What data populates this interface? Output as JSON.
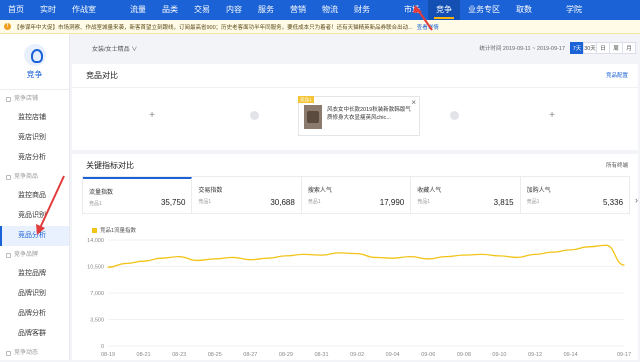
{
  "nav": {
    "items": [
      "首页",
      "实时",
      "作战室",
      "流量",
      "品类",
      "交易",
      "内容",
      "服务",
      "营销",
      "物流",
      "财务",
      "市场",
      "竞争",
      "业务专区",
      "取数",
      "学院"
    ],
    "active_index": 12,
    "dot_indexes": [
      4,
      6
    ]
  },
  "notice": {
    "text": "【参谋年中大促】市场洞察、作战室城量来袭，新客首望立刻跟线，订阅最高省900；历史老客面功半年同服务，要低成本只为着者！还有天猫精英新品券联合出动...",
    "link": "查看详情"
  },
  "sidebar": {
    "title": "竞争",
    "sections": [
      {
        "label": "竞争店铺",
        "items": [
          "监控店铺",
          "竞店识别",
          "竞店分析"
        ]
      },
      {
        "label": "竞争商品",
        "items": [
          "监控商品",
          "竞品识别",
          "竞品分析"
        ]
      },
      {
        "label": "竞争品牌",
        "items": [
          "监控品牌",
          "品牌识别",
          "品牌分析",
          "品牌客群"
        ]
      },
      {
        "label": "竞争动态",
        "items": []
      }
    ],
    "active_item": "竞品分析"
  },
  "toolbar": {
    "category": "女装/女士精品 ∨",
    "period": "统计时间 2019-09-11 ~ 2019-09-17",
    "buttons": [
      "7天",
      "30天",
      "日",
      "周",
      "月"
    ],
    "active_button": 0
  },
  "compare": {
    "title": "竞品对比",
    "config": "竞品配置",
    "slot_plus": "+",
    "badge": "竞品1",
    "product_name": "风衣女中长款2019秋装新款韩版气质修身大衣显瘦英风chic...",
    "close": "×"
  },
  "indicators": {
    "title": "关键指标对比",
    "terminal": "所有终端",
    "metrics": [
      {
        "name": "流量指数",
        "label": "竞品1",
        "value": "35,750"
      },
      {
        "name": "交易指数",
        "label": "竞品1",
        "value": "30,688"
      },
      {
        "name": "搜索人气",
        "label": "竞品1",
        "value": "17,990"
      },
      {
        "name": "收藏人气",
        "label": "竞品1",
        "value": "3,815"
      },
      {
        "name": "加购人气",
        "label": "竞品1",
        "value": "5,336"
      }
    ],
    "selected_metric": 0
  },
  "chart_data": {
    "type": "line",
    "legend": "竞品1流量指数",
    "x": [
      "08-19",
      "08-20",
      "08-21",
      "08-22",
      "08-23",
      "08-24",
      "08-25",
      "08-26",
      "08-27",
      "08-28",
      "08-29",
      "08-30",
      "08-31",
      "09-01",
      "09-02",
      "09-03",
      "09-04",
      "09-05",
      "09-06",
      "09-07",
      "09-08",
      "09-09",
      "09-10",
      "09-11",
      "09-12",
      "09-13",
      "09-14",
      "09-15",
      "09-16",
      "09-17"
    ],
    "x_tick_labels": [
      "08-19",
      "08-21",
      "08-23",
      "08-25",
      "08-27",
      "08-29",
      "08-31",
      "09-02",
      "09-04",
      "09-06",
      "09-08",
      "09-10",
      "09-12",
      "09-14",
      "09-17"
    ],
    "series": [
      {
        "name": "竞品1流量指数",
        "color": "#f2c418",
        "values": [
          10400,
          10900,
          11200,
          11600,
          11800,
          11300,
          11500,
          11700,
          11400,
          11600,
          11900,
          12100,
          12000,
          12300,
          12200,
          11700,
          11600,
          11800,
          11500,
          11800,
          12000,
          12100,
          11900,
          11700,
          12100,
          12400,
          12700,
          13100,
          13300,
          10700
        ]
      }
    ],
    "y_ticks": [
      0,
      3500,
      7000,
      10500,
      14000
    ],
    "y_tick_labels": [
      "0",
      "3,500",
      "7,000",
      "10,500",
      "14,000"
    ],
    "ylim": [
      0,
      14000
    ],
    "grid": true
  }
}
